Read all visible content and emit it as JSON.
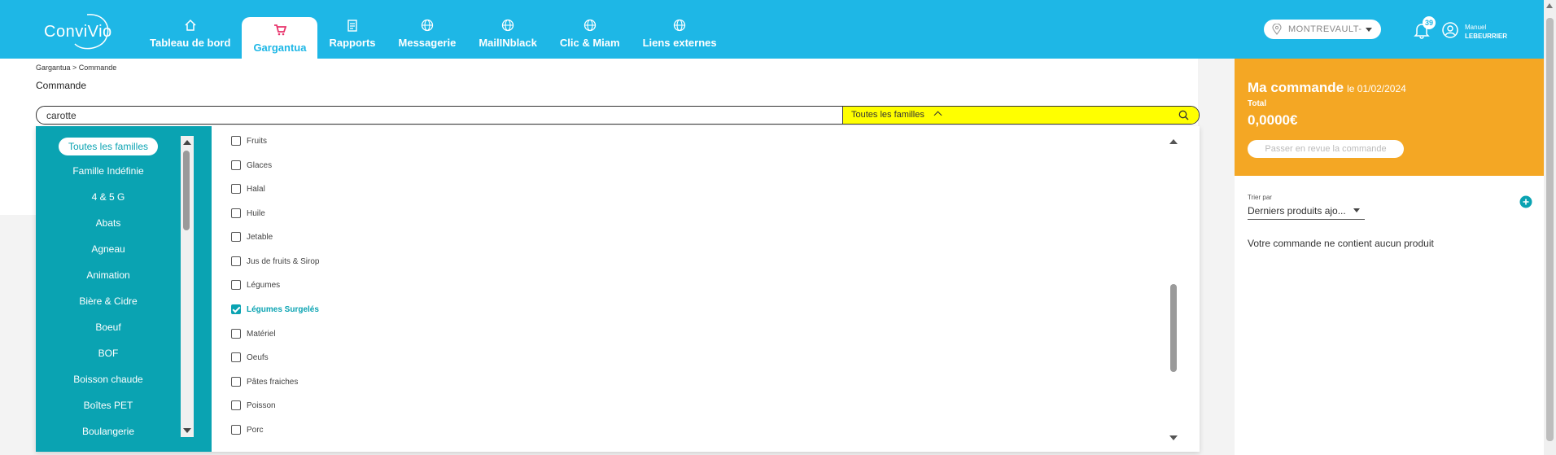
{
  "brand": {
    "logo_text": "ConviVio"
  },
  "nav": {
    "items": [
      {
        "label": "Tableau de bord",
        "icon": "home-icon"
      },
      {
        "label": "Gargantua",
        "icon": "cart-icon",
        "active": true
      },
      {
        "label": "Rapports",
        "icon": "clipboard-icon"
      },
      {
        "label": "Messagerie",
        "icon": "globe-icon"
      },
      {
        "label": "MailINblack",
        "icon": "globe-icon"
      },
      {
        "label": "Clic & Miam",
        "icon": "globe-icon"
      },
      {
        "label": "Liens externes",
        "icon": "globe-icon"
      }
    ]
  },
  "header": {
    "location": "MONTREVAULT-",
    "notifications_count": "39",
    "user_first": "Manuel",
    "user_last": "LEBEURRIER"
  },
  "page": {
    "breadcrumb": "Gargantua > Commande",
    "title": "Commande"
  },
  "search": {
    "value": "carotte",
    "family_select": "Toutes les familles"
  },
  "families": [
    {
      "label": "Toutes les familles",
      "active": true
    },
    {
      "label": "Famille Indéfinie"
    },
    {
      "label": "4 & 5 G"
    },
    {
      "label": "Abats"
    },
    {
      "label": "Agneau"
    },
    {
      "label": "Animation"
    },
    {
      "label": "Bière & Cidre"
    },
    {
      "label": "Boeuf"
    },
    {
      "label": "BOF"
    },
    {
      "label": "Boisson chaude"
    },
    {
      "label": "Boîtes PET"
    },
    {
      "label": "Boulangerie"
    }
  ],
  "subfamilies": [
    {
      "label": "Fruits",
      "checked": false
    },
    {
      "label": "Glaces",
      "checked": false
    },
    {
      "label": "Halal",
      "checked": false
    },
    {
      "label": "Huile",
      "checked": false
    },
    {
      "label": "Jetable",
      "checked": false
    },
    {
      "label": "Jus de fruits & Sirop",
      "checked": false
    },
    {
      "label": "Légumes",
      "checked": false
    },
    {
      "label": "Légumes Surgelés",
      "checked": true
    },
    {
      "label": "Matériel",
      "checked": false
    },
    {
      "label": "Oeufs",
      "checked": false
    },
    {
      "label": "Pâtes fraiches",
      "checked": false
    },
    {
      "label": "Poisson",
      "checked": false
    },
    {
      "label": "Porc",
      "checked": false
    }
  ],
  "order": {
    "title": "Ma commande",
    "date": "le 01/02/2024",
    "total_label": "Total",
    "total_value": "0,0000€",
    "review_button": "Passer en revue la commande",
    "sort_label": "Trier par",
    "sort_value": "Derniers produits ajo...",
    "empty_message": "Votre commande ne contient aucun produit"
  },
  "colors": {
    "header": "#1eb7e6",
    "teal": "#0aa3b2",
    "orange": "#f4a724",
    "highlight": "#ffff00"
  }
}
